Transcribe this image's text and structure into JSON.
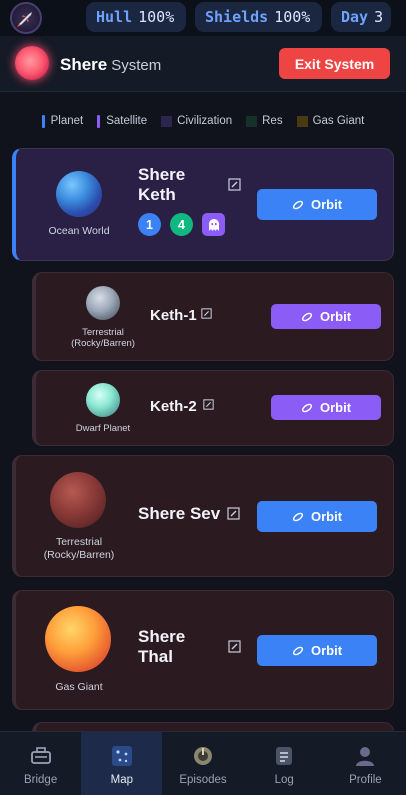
{
  "status": {
    "hull_label": "Hull",
    "hull_value": "100%",
    "shields_label": "Shields",
    "shields_value": "100%",
    "day_label": "Day",
    "day_value": "3"
  },
  "system": {
    "name": "Shere",
    "suffix": "System",
    "exit_label": "Exit System"
  },
  "legend": [
    {
      "label": "Planet",
      "color": "#3b82f6"
    },
    {
      "label": "Satellite",
      "color": "#8b5cf6"
    },
    {
      "label": "Civilization",
      "color": "#2e2450"
    },
    {
      "label": "Res",
      "color": "#16302a"
    },
    {
      "label": "Gas Giant",
      "color": "#4a3a12"
    }
  ],
  "bodies": {
    "keth": {
      "name_line1": "Shere",
      "name_line2": "Keth",
      "type": "Ocean World",
      "badge_blue": "1",
      "badge_green": "4",
      "orbit_label": "Orbit"
    },
    "keth1": {
      "name": "Keth-1",
      "type_line1": "Terrestrial",
      "type_line2": "(Rocky/Barren)",
      "orbit_label": "Orbit"
    },
    "keth2": {
      "name": "Keth-2",
      "type": "Dwarf Planet",
      "orbit_label": "Orbit"
    },
    "sev": {
      "name": "Shere Sev",
      "type_line1": "Terrestrial",
      "type_line2": "(Rocky/Barren)",
      "orbit_label": "Orbit"
    },
    "thal": {
      "name_line1": "Shere",
      "name_line2": "Thal",
      "type": "Gas Giant",
      "orbit_label": "Orbit"
    }
  },
  "nav": [
    {
      "label": "Bridge",
      "icon": "bridge-icon"
    },
    {
      "label": "Map",
      "icon": "map-icon"
    },
    {
      "label": "Episodes",
      "icon": "episodes-icon"
    },
    {
      "label": "Log",
      "icon": "log-icon"
    },
    {
      "label": "Profile",
      "icon": "profile-icon"
    }
  ],
  "colors": {
    "planet_accent": "#3b82f6",
    "satellite_accent": "#8b5cf6",
    "exit_red": "#ef4444"
  }
}
